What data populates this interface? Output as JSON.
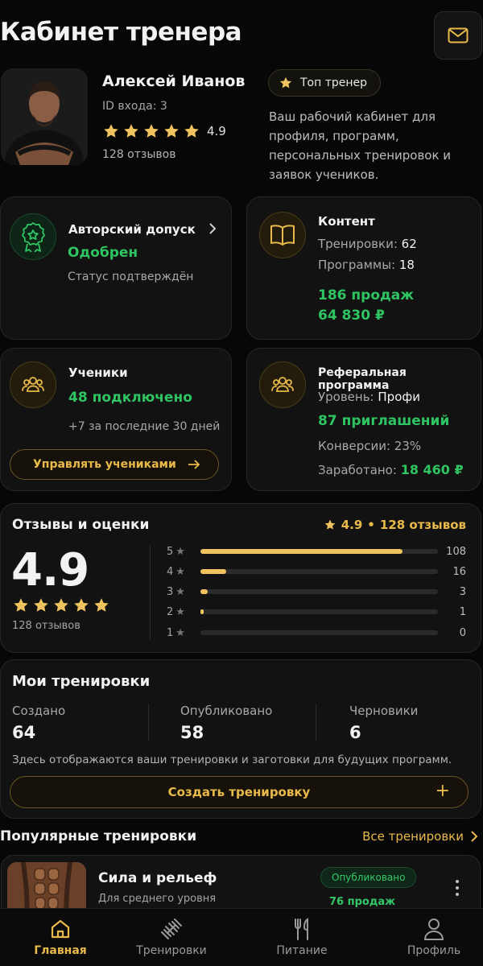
{
  "header": {
    "title": "Кабинет тренера"
  },
  "profile": {
    "name": "Алексей Иванов",
    "id_text": "ID входа: 3",
    "rating": "4.9",
    "stars": 5,
    "reviews_text": "128 отзывов",
    "badge": "Топ тренер",
    "description": "Ваш рабочий кабинет для профиля, программ, персональных тренировок и заявок учеников."
  },
  "author_access": {
    "title": "Авторский допуск",
    "status": "Одобрен",
    "note": "Статус подтверждён",
    "icon": "award-badge-icon"
  },
  "content": {
    "title": "Контент",
    "workouts_label": "Тренировки:",
    "workouts_value": "62",
    "programs_label": "Программы:",
    "programs_value": "18",
    "sales": "186 продаж",
    "revenue": "64 830 ₽",
    "icon": "book-icon"
  },
  "students": {
    "title": "Ученики",
    "connected": "48 подключено",
    "recent": "+7 за последние 30 дней",
    "manage_label": "Управлять учениками",
    "icon": "users-icon"
  },
  "referral": {
    "title": "Реферальная программа",
    "level_label": "Уровень:",
    "level_value": "Профи",
    "invites": "87 приглашений",
    "conversion": "Конверсии: 23%",
    "earned_label": "Заработано:",
    "earned_value": "18 460 ₽",
    "icon": "users-icon"
  },
  "reviews": {
    "title": "Отзывы и оценки",
    "summary_rating": "4.9",
    "summary_dot": "•",
    "summary_count": "128 отзывов",
    "big_rating": "4.9",
    "count_text": "128 отзывов",
    "breakdown": [
      {
        "stars": "5",
        "count": "108",
        "fraction": 0.85
      },
      {
        "stars": "4",
        "count": "16",
        "fraction": 0.11
      },
      {
        "stars": "3",
        "count": "3",
        "fraction": 0.03
      },
      {
        "stars": "2",
        "count": "1",
        "fraction": 0.01
      },
      {
        "stars": "1",
        "count": "0",
        "fraction": 0
      }
    ]
  },
  "my_workouts": {
    "title": "Мои тренировки",
    "stats": [
      {
        "label": "Создано",
        "value": "64"
      },
      {
        "label": "Опубликовано",
        "value": "58"
      },
      {
        "label": "Черновики",
        "value": "6"
      }
    ],
    "note": "Здесь отображаются ваши тренировки и заготовки для будущих программ.",
    "create_label": "Создать тренировку",
    "create_icon": "+"
  },
  "popular": {
    "title": "Популярные тренировки",
    "all_label": "Все тренировки",
    "items": [
      {
        "name": "Сила и рельеф",
        "level": "Для среднего уровня",
        "status": "Опубликовано",
        "sales": "76 продаж"
      }
    ]
  },
  "tabbar": {
    "items": [
      {
        "label": "Главная",
        "icon": "home-icon",
        "active": true
      },
      {
        "label": "Тренировки",
        "icon": "dumbbell-icon",
        "active": false
      },
      {
        "label": "Питание",
        "icon": "fork-knife-icon",
        "active": false
      },
      {
        "label": "Профиль",
        "icon": "user-icon",
        "active": false
      }
    ]
  },
  "colors": {
    "accent": "#e9b949",
    "success": "#2fc462",
    "background": "#070707",
    "card": "#121212"
  }
}
